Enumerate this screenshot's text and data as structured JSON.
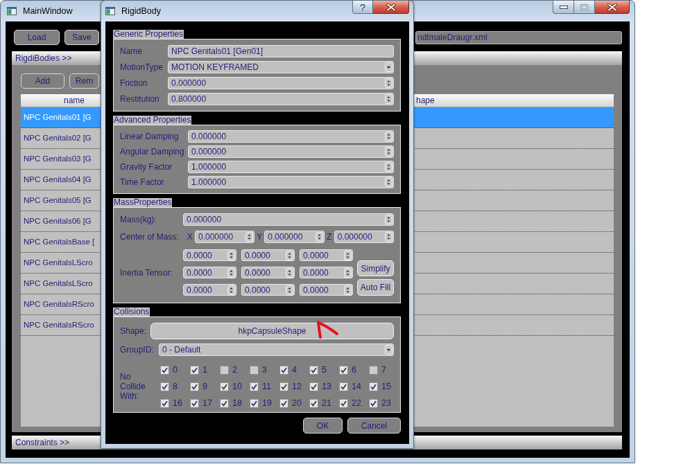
{
  "main_window": {
    "title": "MainWindow",
    "toolbar": {
      "buttons": [
        "Load",
        "Save"
      ],
      "file_path": "ndtmaleDraugr.xml"
    },
    "rigid_bodies": {
      "header": "RigdiBodies >>",
      "buttons": [
        "Add",
        "Rem"
      ],
      "table": {
        "columns": [
          "name",
          "hape"
        ],
        "rows": [
          {
            "name": "NPC Genitals01 [G",
            "selected": true
          },
          {
            "name": "NPC Genitals02 [G",
            "selected": false
          },
          {
            "name": "NPC Genitals03 [G",
            "selected": false
          },
          {
            "name": "NPC Genitals04 [G",
            "selected": false
          },
          {
            "name": "NPC Genitals05 [G",
            "selected": false
          },
          {
            "name": "NPC Genitals06 [G",
            "selected": false
          },
          {
            "name": "NPC GenitalsBase [",
            "selected": false
          },
          {
            "name": "NPC GenitalsLScro",
            "selected": false
          },
          {
            "name": "NPC GenitalsLScro",
            "selected": false
          },
          {
            "name": "NPC GenitalsRScro",
            "selected": false
          },
          {
            "name": "NPC GenitalsRScro",
            "selected": false
          }
        ]
      }
    },
    "constraints": {
      "header": "Constraints >>"
    }
  },
  "dialog": {
    "title": "RigidBody",
    "help_button": "?",
    "generic_properties": {
      "title": "Generic Properties",
      "fields": [
        {
          "label": "Name",
          "kind": "text",
          "value": "NPC Genitals01 [Gen01]"
        },
        {
          "label": "MotionType",
          "kind": "combo",
          "value": "MOTION KEYFRAMED"
        },
        {
          "label": "Friction",
          "kind": "spin",
          "value": "0.000000"
        },
        {
          "label": "Restitution",
          "kind": "spin",
          "value": "0.800000"
        }
      ]
    },
    "advanced_properties": {
      "title": "Advanced Properties",
      "fields": [
        {
          "label": "Linear Damping",
          "kind": "spin",
          "value": "0.000000"
        },
        {
          "label": "Angular Damping",
          "kind": "spin",
          "value": "0.000000"
        },
        {
          "label": "Gravity Factor",
          "kind": "spin",
          "value": "1.000000"
        },
        {
          "label": "Time Factor",
          "kind": "spin",
          "value": "1.000000"
        }
      ]
    },
    "mass_properties": {
      "title": "MassProperties",
      "mass": {
        "label": "Mass(kg):",
        "value": "0.000000"
      },
      "center_of_mass": {
        "label": "Center of Mass:",
        "axes": [
          {
            "axis": "X",
            "value": "0.000000"
          },
          {
            "axis": "Y",
            "value": "0.000000"
          },
          {
            "axis": "Z",
            "value": "0.000000"
          }
        ]
      },
      "inertia_tensor": {
        "label": "Inertia Tensor:",
        "rows": [
          [
            "0.0000",
            "0.0000",
            "0.0000"
          ],
          [
            "0.0000",
            "0.0000",
            "0.0000"
          ],
          [
            "0.0000",
            "0.0000",
            "0.0000"
          ]
        ]
      },
      "buttons": [
        "Simplify",
        "Auto Fill"
      ]
    },
    "collisions": {
      "title": "Collisions",
      "shape": {
        "label": "Shape:",
        "value": "hkpCapsuleShape"
      },
      "group_id": {
        "label": "GroupID:",
        "value": "0 - Default"
      },
      "no_collide_with": {
        "label": "No Collide With:",
        "layers": [
          {
            "label": "0",
            "checked": true
          },
          {
            "label": "1",
            "checked": true
          },
          {
            "label": "2",
            "checked": false
          },
          {
            "label": "3",
            "checked": false
          },
          {
            "label": "4",
            "checked": true
          },
          {
            "label": "5",
            "checked": true
          },
          {
            "label": "6",
            "checked": true
          },
          {
            "label": "7",
            "checked": false
          },
          {
            "label": "8",
            "checked": true
          },
          {
            "label": "9",
            "checked": true
          },
          {
            "label": "10",
            "checked": true
          },
          {
            "label": "11",
            "checked": true
          },
          {
            "label": "12",
            "checked": true
          },
          {
            "label": "13",
            "checked": true
          },
          {
            "label": "14",
            "checked": true
          },
          {
            "label": "15",
            "checked": true
          },
          {
            "label": "16",
            "checked": true
          },
          {
            "label": "17",
            "checked": true
          },
          {
            "label": "18",
            "checked": true
          },
          {
            "label": "19",
            "checked": true
          },
          {
            "label": "20",
            "checked": true
          },
          {
            "label": "21",
            "checked": true
          },
          {
            "label": "22",
            "checked": true
          },
          {
            "label": "23",
            "checked": true
          }
        ]
      }
    },
    "buttons": [
      "OK",
      "Cancel"
    ]
  }
}
